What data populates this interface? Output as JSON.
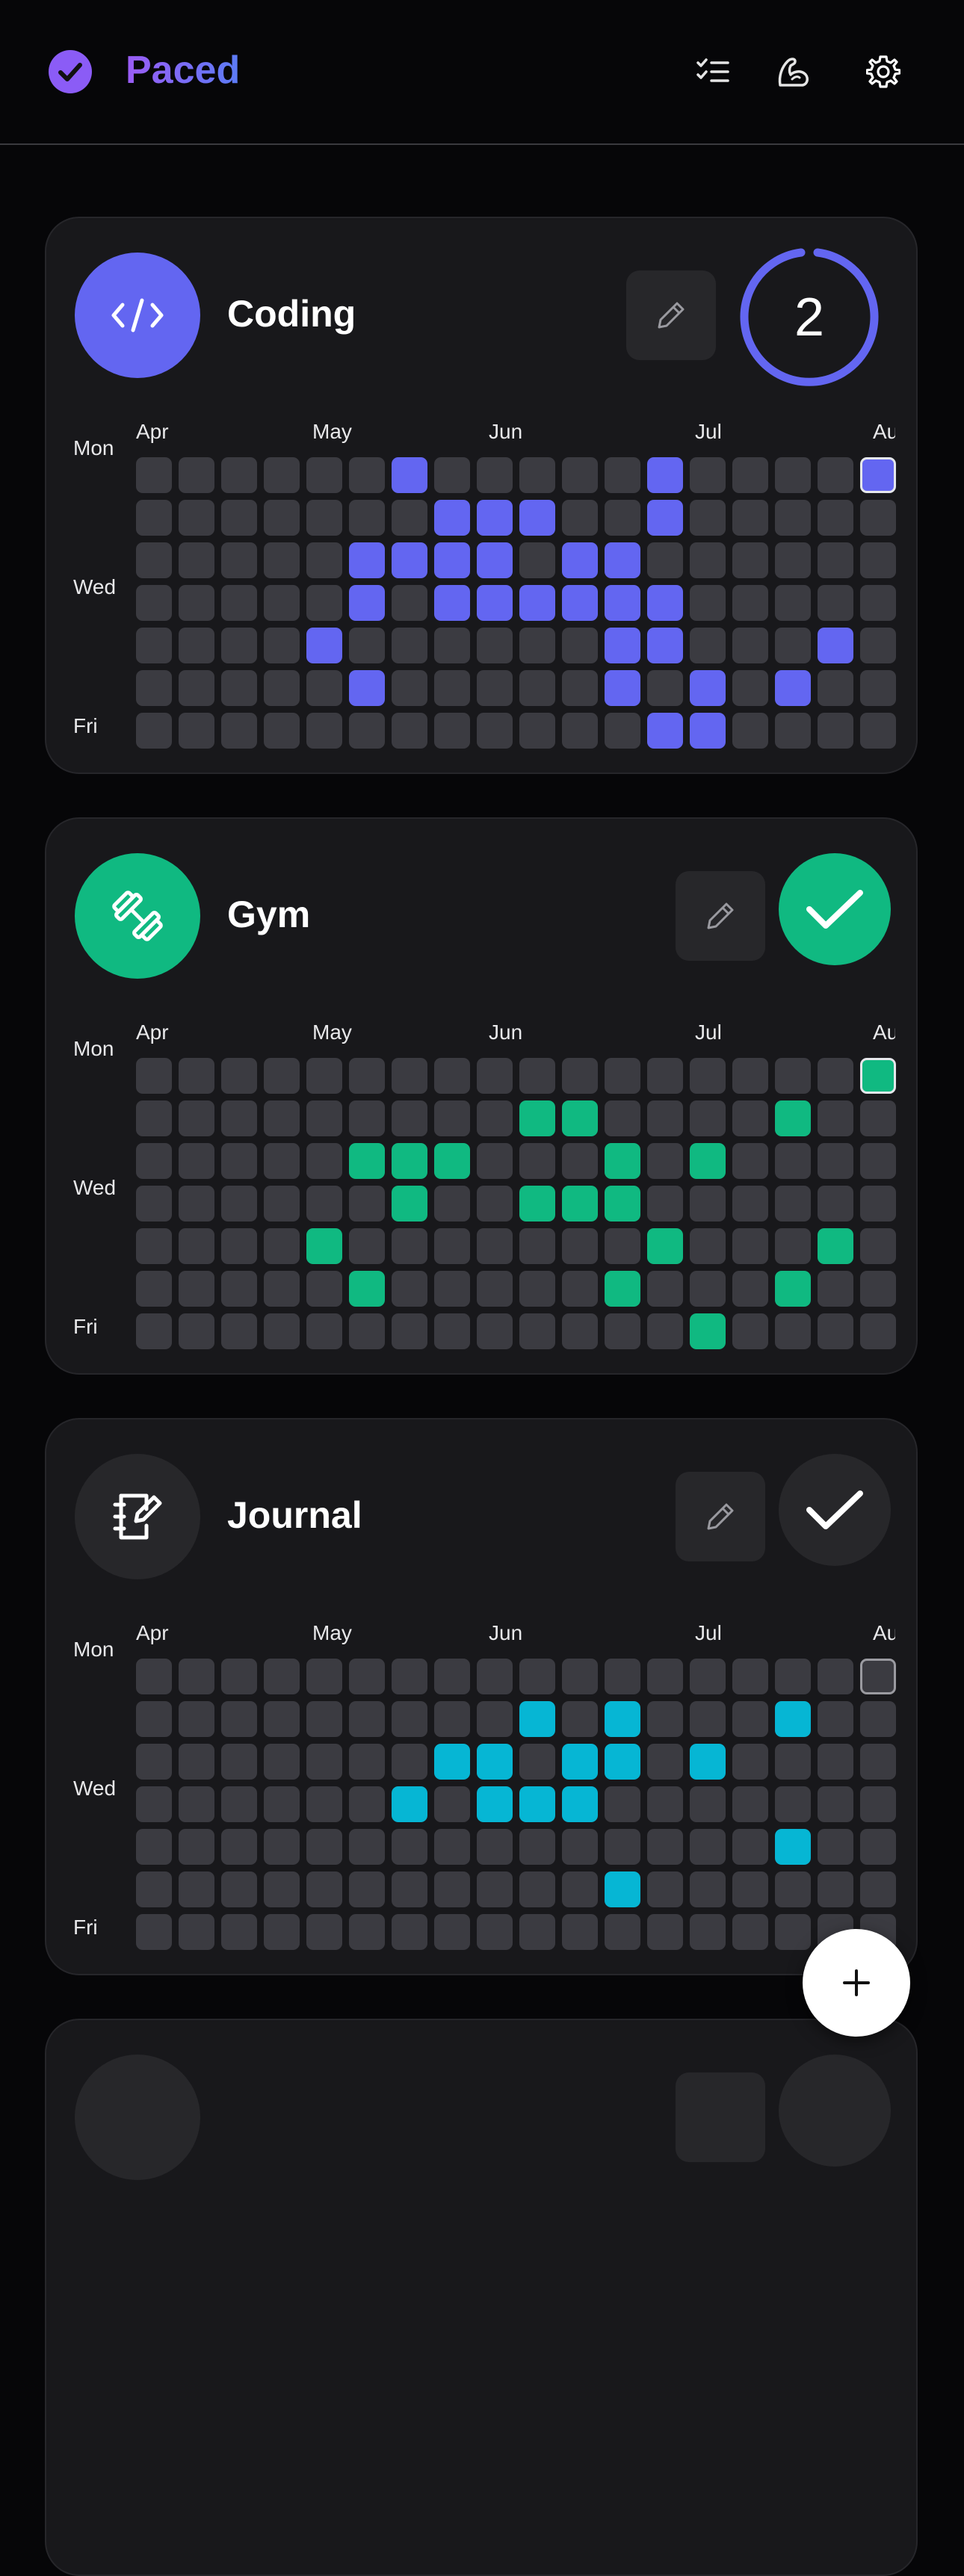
{
  "app": {
    "title": "Paced",
    "accent_gradient": [
      "#9b5cf6",
      "#5b7cf6"
    ]
  },
  "header": {
    "icons": [
      "check-circle-icon",
      "checklist-icon",
      "flexed-arm-icon",
      "gear-icon"
    ]
  },
  "months": [
    "Apr",
    "May",
    "Jun",
    "Jul",
    "Au"
  ],
  "day_labels": {
    "mon": "Mon",
    "wed": "Wed",
    "fri": "Fri"
  },
  "habits": [
    {
      "name": "Coding",
      "icon": "code-icon",
      "color": "#6366f1",
      "status": "streak",
      "streak": "2",
      "grid": [
        "000000100000100001",
        "000000011100100000",
        "000001111011000000",
        "000001011111100000",
        "000010000001100010",
        "000001000001010100",
        "000000000000110000"
      ]
    },
    {
      "name": "Gym",
      "icon": "dumbbell-icon",
      "color": "#10b981",
      "status": "done",
      "grid": [
        "000000000000000001",
        "000000000110000100",
        "000001110001010000",
        "000000100111000000",
        "000010000000100010",
        "000001000001000100",
        "000000000000010000"
      ]
    },
    {
      "name": "Journal",
      "icon": "journal-icon",
      "color": "#06b6d4",
      "status": "pending",
      "grid": [
        "000000000000000002",
        "000000000101000100",
        "000000011011010000",
        "000000101110000000",
        "000000000000000100",
        "000000000001000000",
        "000000000000000000"
      ]
    }
  ],
  "fab": {
    "icon": "plus-icon"
  }
}
